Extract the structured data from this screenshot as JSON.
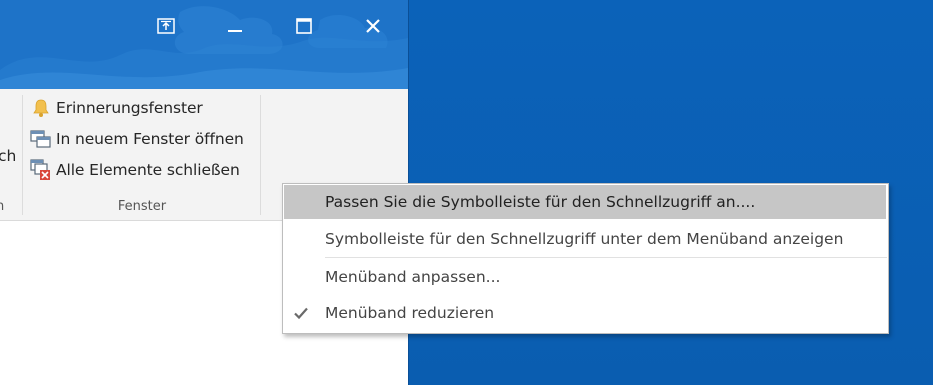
{
  "window": {
    "title_buttons": {
      "ribbon_display_icon": "ribbon-display-options-icon",
      "minimize_icon": "minimize-icon",
      "maximize_icon": "maximize-icon",
      "close_icon": "close-icon"
    }
  },
  "ribbon": {
    "cut_label_left": "ch",
    "cut_group_label_left": "n",
    "group": {
      "label": "Fenster",
      "items": [
        {
          "label": "Erinnerungsfenster",
          "icon": "bell-icon"
        },
        {
          "label": "In neuem Fenster öffnen",
          "icon": "new-window-icon"
        },
        {
          "label": "Alle Elemente schließen",
          "icon": "close-all-items-icon"
        }
      ]
    }
  },
  "context_menu": {
    "items": [
      {
        "label": "Passen Sie die Symbolleiste für den Schnellzugriff an....",
        "highlighted": true
      },
      {
        "label": "Symbolleiste für den Schnellzugriff unter dem Menüband anzeigen",
        "highlighted": false
      },
      {
        "label": "Menüband anpassen...",
        "highlighted": false
      },
      {
        "label": "Menüband reduzieren",
        "checked": true,
        "check_icon": "checkmark-icon"
      }
    ]
  },
  "colors": {
    "desktop": "#0a5fb4",
    "titlebar": "#1e73c8",
    "ribbon_bg": "#f3f3f3",
    "menu_highlight": "#c6c6c6"
  }
}
